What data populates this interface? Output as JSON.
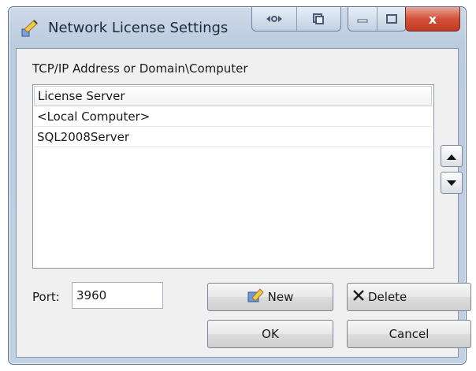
{
  "window": {
    "title": "Network License Settings"
  },
  "icons": {
    "app": "network-license-icon",
    "caption_a": "caption-extra-icon",
    "caption_b": "caption-extra-icon-2",
    "minimize": "minimize-icon",
    "maximize": "maximize-icon",
    "close": "close-icon",
    "move_up": "arrow-up-icon",
    "move_down": "arrow-down-icon",
    "new": "new-pencil-icon",
    "delete": "delete-x-icon"
  },
  "caption": {
    "close": "x"
  },
  "address_label": "TCP/IP Address or Domain\\Computer",
  "server_list": {
    "column_header": "License Server",
    "rows": [
      "<Local Computer>",
      "SQL2008Server"
    ]
  },
  "port": {
    "label": "Port:",
    "value": "3960"
  },
  "buttons": {
    "new": "New",
    "delete": "Delete",
    "ok": "OK",
    "cancel": "Cancel"
  }
}
